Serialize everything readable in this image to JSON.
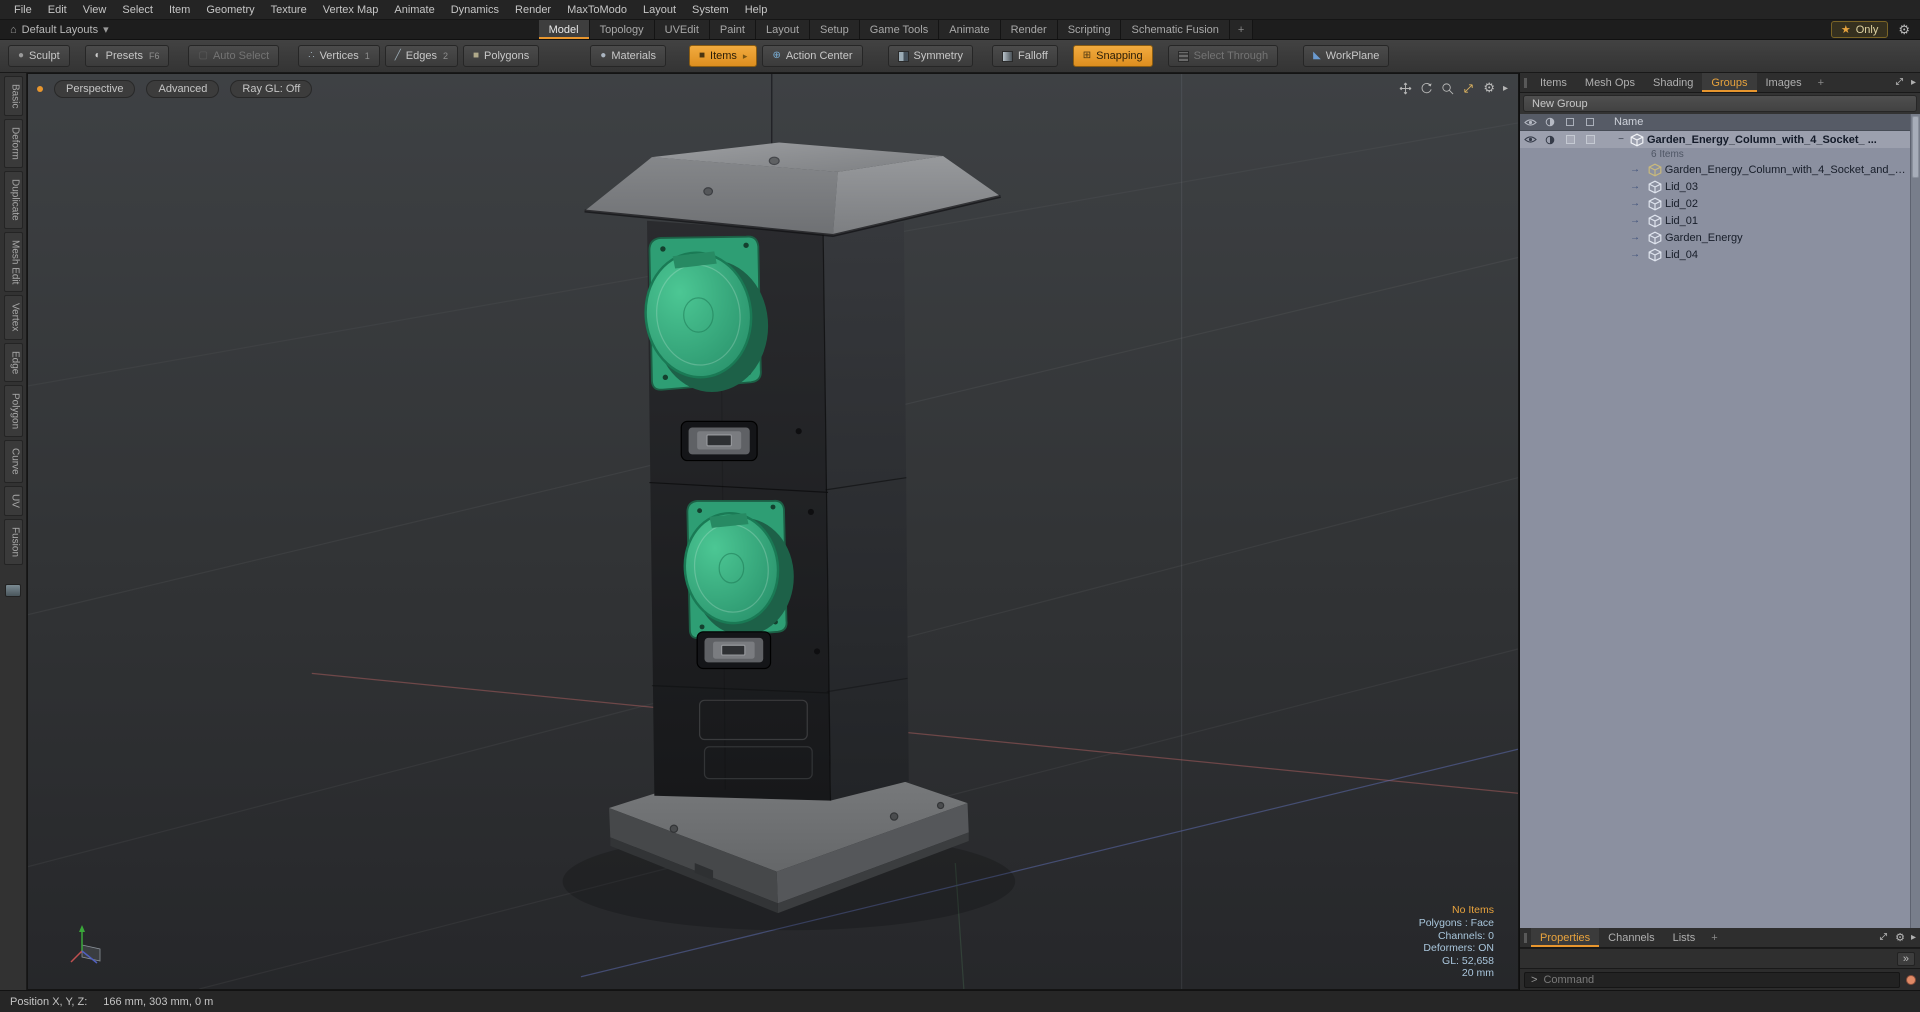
{
  "menubar": {
    "items": [
      "File",
      "Edit",
      "View",
      "Select",
      "Item",
      "Geometry",
      "Texture",
      "Vertex Map",
      "Animate",
      "Dynamics",
      "Render",
      "MaxToModo",
      "Layout",
      "System",
      "Help"
    ]
  },
  "layoutbar": {
    "layouts_label": "Default Layouts",
    "tabs": [
      "Model",
      "Topology",
      "UVEdit",
      "Paint",
      "Layout",
      "Setup",
      "Game Tools",
      "Animate",
      "Render",
      "Scripting",
      "Schematic Fusion"
    ],
    "add_tab": "+",
    "only_label": "Only"
  },
  "toolbar": {
    "sculpt": "Sculpt",
    "presets": "Presets",
    "presets_key": "F6",
    "auto_select": "Auto Select",
    "vertices": "Vertices",
    "vertices_num": "1",
    "edges": "Edges",
    "edges_num": "2",
    "polygons": "Polygons",
    "materials": "Materials",
    "items": "Items",
    "action_center": "Action Center",
    "symmetry": "Symmetry",
    "falloff": "Falloff",
    "snapping": "Snapping",
    "select_through": "Select Through",
    "workplane": "WorkPlane"
  },
  "left_tabs": [
    "Basic",
    "Deform",
    "Duplicate",
    "Mesh Edit",
    "Vertex",
    "Edge",
    "Polygon",
    "Curve",
    "UV",
    "Fusion"
  ],
  "viewport": {
    "buttons": [
      "Perspective",
      "Advanced",
      "Ray GL: Off"
    ],
    "info": {
      "no_items": "No Items",
      "polygons": "Polygons : Face",
      "channels": "Channels: 0",
      "deformers": "Deformers: ON",
      "gl": "GL: 52,658",
      "scale": "20 mm"
    }
  },
  "right_panel": {
    "tabs": [
      "Items",
      "Mesh Ops",
      "Shading",
      "Groups",
      "Images"
    ],
    "add_tab": "+",
    "new_group_label": "New Group",
    "name_header": "Name",
    "group_name": "Garden_Energy_Column_with_4_Socket_ ...",
    "group_count": "6 Items",
    "children": [
      "Garden_Energy_Column_with_4_Socket_and_S...",
      "Lid_03",
      "Lid_02",
      "Lid_01",
      "Garden_Energy",
      "Lid_04"
    ],
    "bottom_tabs": [
      "Properties",
      "Channels",
      "Lists"
    ],
    "bottom_add": "+",
    "expand_label": "»"
  },
  "command": {
    "prompt": ">",
    "placeholder": "Command"
  },
  "statusbar": {
    "label": "Position X, Y, Z:",
    "value": "166 mm, 303 mm, 0 m"
  },
  "icons": {
    "home": "⌂",
    "dropdown": "▾",
    "star": "★",
    "gear": "⚙",
    "sculpt": "●",
    "presets": "◐",
    "auto_select": "▢",
    "vertices": "∴",
    "edges": "╱",
    "polygons": "■",
    "materials": "●",
    "items": "■",
    "action_center": "⊕",
    "snapping": "⊞",
    "workplane": "◣",
    "arrow_right": "▸",
    "member_arrow": "→",
    "expander": "−"
  },
  "colors": {
    "accent": "#e8962e",
    "socket_green": "#2e9e74",
    "tree_bg": "#8b90a0"
  }
}
